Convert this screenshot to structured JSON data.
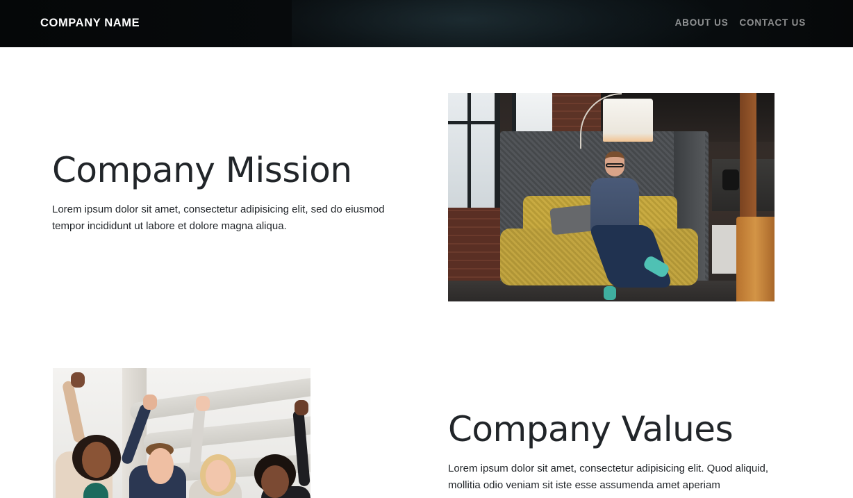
{
  "navbar": {
    "brand": "COMPANY NAME",
    "links": [
      "ABOUT US",
      "CONTACT US"
    ]
  },
  "sections": [
    {
      "heading": "Company Mission",
      "text": "Lorem ipsum dolor sit amet, consectetur adipisicing elit, sed do eiusmod tempor incididunt ut labore et dolore magna aliqua."
    },
    {
      "heading": "Company Values",
      "text": "Lorem ipsum dolor sit amet, consectetur adipisicing elit. Quod aliquid, mollitia odio veniam sit iste esse assumenda amet aperiam"
    }
  ],
  "colors": {
    "navbar_bg": "#060809",
    "brand": "#ffffff",
    "nav_link": "#8c8f91",
    "heading": "#212529",
    "body_text": "#212529"
  }
}
